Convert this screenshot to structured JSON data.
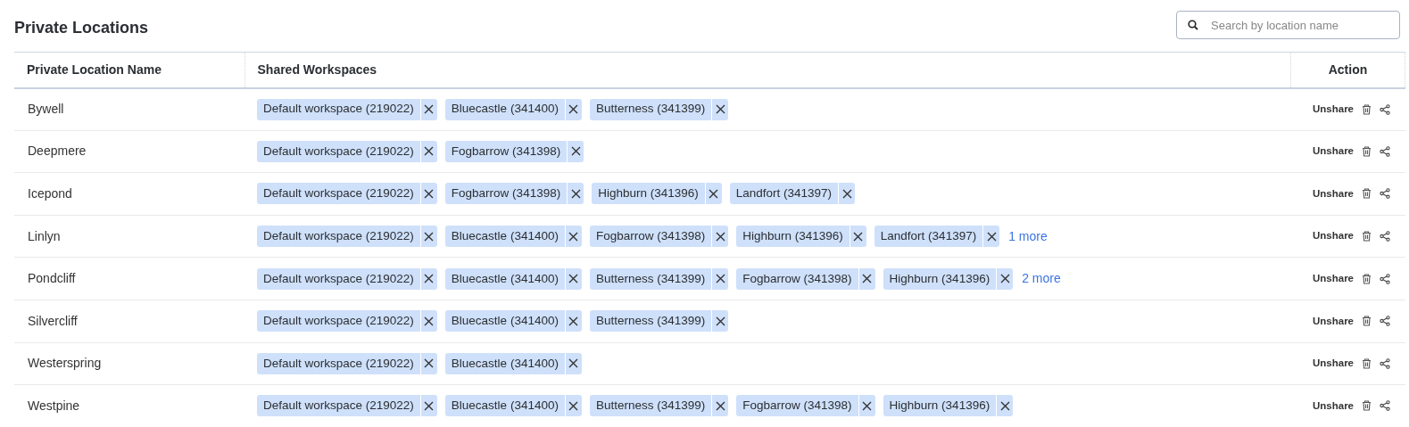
{
  "page": {
    "title": "Private Locations"
  },
  "search": {
    "placeholder": "Search by location name"
  },
  "table": {
    "columns": [
      "Private Location Name",
      "Shared Workspaces",
      "Action"
    ],
    "rows": [
      {
        "name": "Bywell",
        "workspaces": [
          "Default workspace (219022)",
          "Bluecastle (341400)",
          "Butterness (341399)"
        ],
        "action": "Unshare"
      },
      {
        "name": "Deepmere",
        "workspaces": [
          "Default workspace (219022)",
          "Fogbarrow (341398)"
        ],
        "action": "Unshare"
      },
      {
        "name": "Icepond",
        "workspaces": [
          "Default workspace (219022)",
          "Fogbarrow (341398)",
          "Highburn (341396)",
          "Landfort (341397)"
        ],
        "action": "Unshare"
      },
      {
        "name": "Linlyn",
        "workspaces": [
          "Default workspace (219022)",
          "Bluecastle (341400)",
          "Fogbarrow (341398)",
          "Highburn (341396)",
          "Landfort (341397)"
        ],
        "more": "1 more",
        "action": "Unshare"
      },
      {
        "name": "Pondcliff",
        "workspaces": [
          "Default workspace (219022)",
          "Bluecastle (341400)",
          "Butterness (341399)",
          "Fogbarrow (341398)",
          "Highburn (341396)"
        ],
        "more": "2 more",
        "action": "Unshare"
      },
      {
        "name": "Silvercliff",
        "workspaces": [
          "Default workspace (219022)",
          "Bluecastle (341400)",
          "Butterness (341399)"
        ],
        "action": "Unshare"
      },
      {
        "name": "Westerspring",
        "workspaces": [
          "Default workspace (219022)",
          "Bluecastle (341400)"
        ],
        "action": "Unshare"
      },
      {
        "name": "Westpine",
        "workspaces": [
          "Default workspace (219022)",
          "Bluecastle (341400)",
          "Butterness (341399)",
          "Fogbarrow (341398)",
          "Highburn (341396)"
        ],
        "action": "Unshare"
      }
    ]
  }
}
